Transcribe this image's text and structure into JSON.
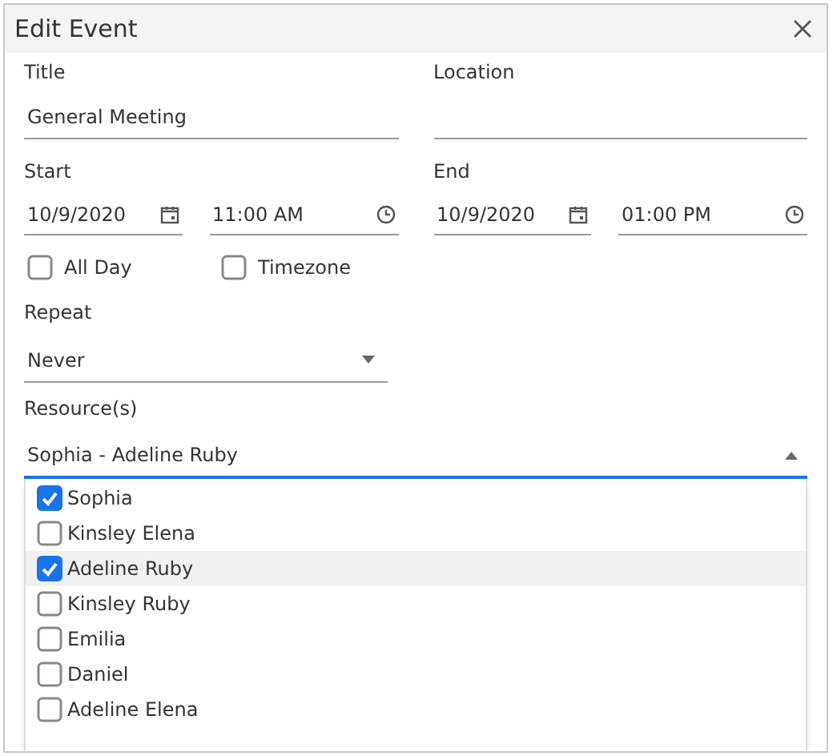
{
  "window": {
    "title": "Edit Event"
  },
  "title_field": {
    "label": "Title",
    "value": "General Meeting"
  },
  "location_field": {
    "label": "Location"
  },
  "start": {
    "label": "Start",
    "date": "10/9/2020",
    "time": "11:00 AM"
  },
  "end": {
    "label": "End",
    "date": "10/9/2020",
    "time": "01:00 PM"
  },
  "options": [
    {
      "label": "All Day",
      "checked": false
    },
    {
      "label": "Timezone",
      "checked": false
    }
  ],
  "repeat": {
    "label": "Repeat",
    "value": "Never"
  },
  "resources": {
    "label": "Resource(s)",
    "value": "Sophia - Adeline Ruby",
    "expanded": true,
    "items": [
      {
        "label": "Sophia",
        "checked": true,
        "highlighted": false
      },
      {
        "label": "Kinsley Elena",
        "checked": false,
        "highlighted": false
      },
      {
        "label": "Adeline Ruby",
        "checked": true,
        "highlighted": true
      },
      {
        "label": "Kinsley Ruby",
        "checked": false,
        "highlighted": false
      },
      {
        "label": "Emilia",
        "checked": false,
        "highlighted": false
      },
      {
        "label": "Daniel",
        "checked": false,
        "highlighted": false
      },
      {
        "label": "Adeline Elena",
        "checked": false,
        "highlighted": false
      }
    ]
  }
}
